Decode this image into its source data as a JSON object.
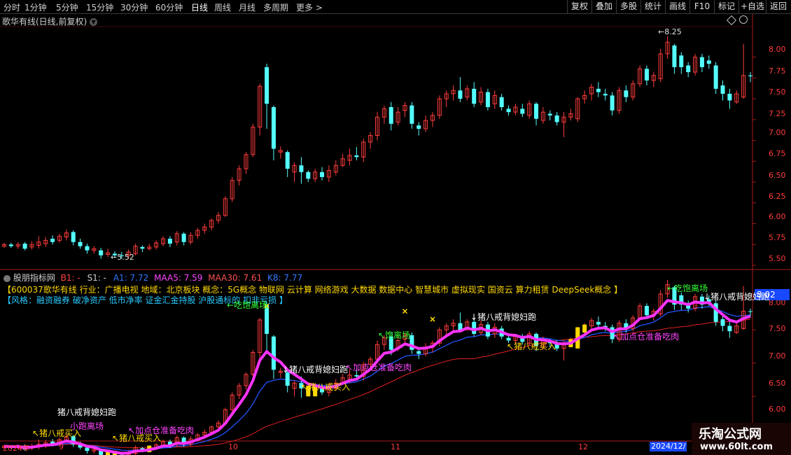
{
  "toolbar": {
    "tabs": [
      "分时",
      "1分钟",
      "5分钟",
      "15分钟",
      "30分钟",
      "60分钟",
      "日线",
      "周线",
      "月线",
      "多周期",
      "更多 >"
    ],
    "right_buttons": [
      "复权",
      "叠加",
      "多股",
      "统计",
      "画线",
      "F10",
      "标记",
      "+自选",
      "返回"
    ]
  },
  "upper": {
    "title": "歌华有线(日线,前复权)",
    "price_ticks": [
      "8.00",
      "7.75",
      "7.50",
      "7.25",
      "7.00",
      "6.75",
      "6.50",
      "6.25",
      "6.00",
      "5.75",
      "5.50"
    ],
    "high_label": "8.25",
    "low_label": "5.52"
  },
  "indicator": {
    "name": "股朋指标网",
    "b1_label": "B1: -",
    "s1_label": "S1: -",
    "a1_label": "A1: 7.72",
    "maa5_label": "MAA5: 7.59",
    "maa30_label": "MAA30: 7.61",
    "k8_label": "K8: 7.77",
    "info_line1": "【600037歌华有线 行业：广播电视 地域：北京板块 概念：5G概念 物联网 云计算 网络游戏 大数据 数据中心 智慧城市 虚拟现实 国资云 算力租赁 DeepSeek概念 】",
    "info_line2": "【风格：融资融券 破净资产 低市净率 证金汇金持股 沪股通标的 扣非亏损 】",
    "price_ticks": [
      "8.00",
      "7.50",
      "7.00",
      "6.50",
      "6.00"
    ],
    "current_value": "8.02"
  },
  "annotations": {
    "zhubajie_paolu": "猪八戒背媳妇跑",
    "zhubajie_buy": "猪八戒买入",
    "chibao_lichang": "吃饱离场",
    "jiadian_cang": "加点仓准备吃肉",
    "lichang_short": "饱离场",
    "xiaoqian": "小跑离场"
  },
  "dates": [
    "2024年",
    "9",
    "10",
    "11",
    "12",
    "2024/12/"
  ],
  "watermark": {
    "title": "乐淘公式网",
    "url": "www.60lt.com"
  },
  "colors": {
    "up": "#ff3c3c",
    "down": "#54ffff",
    "ma_magenta": "#ff33ff",
    "ma_blue": "#2255ff",
    "ma_red": "#e02020",
    "signal_yellow": "#ffd800",
    "label_green": "#33ff33",
    "label_white": "#ffffff"
  },
  "chart_data": {
    "type": "candlestick",
    "y_range_upper": [
      5.45,
      8.35
    ],
    "y_range_lower": [
      5.85,
      8.25
    ],
    "candles": [
      [
        5.73,
        5.75,
        5.71,
        5.77
      ],
      [
        5.75,
        5.73,
        5.71,
        5.77
      ],
      [
        5.73,
        5.75,
        5.7,
        5.78
      ],
      [
        5.76,
        5.7,
        5.68,
        5.78
      ],
      [
        5.72,
        5.75,
        5.69,
        5.79
      ],
      [
        5.74,
        5.78,
        5.7,
        5.85
      ],
      [
        5.76,
        5.8,
        5.72,
        5.84
      ],
      [
        5.82,
        5.78,
        5.75,
        5.86
      ],
      [
        5.8,
        5.85,
        5.77,
        5.88
      ],
      [
        5.84,
        5.89,
        5.8,
        5.93
      ],
      [
        5.9,
        5.78,
        5.74,
        5.92
      ],
      [
        5.78,
        5.73,
        5.7,
        5.82
      ],
      [
        5.73,
        5.68,
        5.64,
        5.76
      ],
      [
        5.68,
        5.7,
        5.64,
        5.73
      ],
      [
        5.68,
        5.62,
        5.58,
        5.71
      ],
      [
        5.63,
        5.65,
        5.6,
        5.7
      ],
      [
        5.64,
        5.62,
        5.59,
        5.67
      ],
      [
        5.62,
        5.61,
        5.58,
        5.66
      ],
      [
        5.62,
        5.66,
        5.58,
        5.69
      ],
      [
        5.64,
        5.73,
        5.62,
        5.76
      ],
      [
        5.72,
        5.7,
        5.66,
        5.74
      ],
      [
        5.7,
        5.72,
        5.68,
        5.76
      ],
      [
        5.72,
        5.77,
        5.69,
        5.8
      ],
      [
        5.76,
        5.82,
        5.73,
        5.85
      ],
      [
        5.82,
        5.76,
        5.72,
        5.85
      ],
      [
        5.78,
        5.88,
        5.74,
        5.91
      ],
      [
        5.88,
        5.78,
        5.74,
        5.9
      ],
      [
        5.78,
        5.86,
        5.75,
        5.9
      ],
      [
        5.86,
        5.92,
        5.82,
        5.95
      ],
      [
        5.92,
        5.96,
        5.88,
        6.0
      ],
      [
        5.96,
        6.04,
        5.92,
        6.06
      ],
      [
        6.04,
        6.1,
        6.0,
        6.14
      ],
      [
        6.1,
        6.3,
        6.08,
        6.33
      ],
      [
        6.3,
        6.52,
        6.26,
        6.56
      ],
      [
        6.52,
        6.66,
        6.46,
        6.7
      ],
      [
        6.66,
        6.83,
        6.6,
        6.86
      ],
      [
        6.83,
        7.16,
        6.8,
        7.2
      ],
      [
        7.16,
        7.65,
        7.06,
        7.68
      ],
      [
        7.88,
        7.44,
        7.14,
        7.92
      ],
      [
        7.4,
        6.9,
        6.76,
        7.42
      ],
      [
        6.86,
        6.88,
        6.78,
        6.93
      ],
      [
        6.86,
        6.66,
        6.56,
        6.88
      ],
      [
        6.62,
        6.7,
        6.5,
        6.74
      ],
      [
        6.7,
        6.62,
        6.48,
        6.8
      ],
      [
        6.62,
        6.54,
        6.5,
        6.64
      ],
      [
        6.54,
        6.62,
        6.5,
        6.66
      ],
      [
        6.62,
        6.56,
        6.52,
        6.68
      ],
      [
        6.56,
        6.64,
        6.5,
        6.7
      ],
      [
        6.62,
        6.7,
        6.58,
        6.76
      ],
      [
        6.7,
        6.78,
        6.68,
        6.84
      ],
      [
        6.76,
        6.82,
        6.7,
        6.9
      ],
      [
        6.82,
        6.8,
        6.76,
        6.92
      ],
      [
        6.8,
        6.98,
        6.74,
        7.02
      ],
      [
        6.98,
        7.06,
        6.9,
        7.1
      ],
      [
        7.06,
        7.28,
        7.0,
        7.34
      ],
      [
        7.28,
        7.38,
        7.2,
        7.42
      ],
      [
        7.4,
        7.2,
        7.12,
        7.46
      ],
      [
        7.22,
        7.34,
        7.18,
        7.4
      ],
      [
        7.36,
        7.42,
        7.28,
        7.46
      ],
      [
        7.42,
        7.2,
        7.14,
        7.46
      ],
      [
        7.18,
        7.14,
        7.06,
        7.22
      ],
      [
        7.14,
        7.24,
        7.1,
        7.3
      ],
      [
        7.24,
        7.3,
        7.16,
        7.34
      ],
      [
        7.3,
        7.5,
        7.26,
        7.54
      ],
      [
        7.5,
        7.56,
        7.4,
        7.6
      ],
      [
        7.56,
        7.6,
        7.48,
        7.66
      ],
      [
        7.6,
        7.5,
        7.46,
        7.76
      ],
      [
        7.52,
        7.62,
        7.48,
        7.66
      ],
      [
        7.62,
        7.44,
        7.4,
        7.7
      ],
      [
        7.46,
        7.58,
        7.42,
        7.64
      ],
      [
        7.58,
        7.4,
        7.36,
        7.62
      ],
      [
        7.44,
        7.54,
        7.38,
        7.6
      ],
      [
        7.52,
        7.4,
        7.36,
        7.56
      ],
      [
        7.38,
        7.34,
        7.3,
        7.42
      ],
      [
        7.34,
        7.4,
        7.3,
        7.44
      ],
      [
        7.38,
        7.32,
        7.28,
        7.44
      ],
      [
        7.3,
        7.44,
        7.26,
        7.48
      ],
      [
        7.44,
        7.26,
        7.18,
        7.46
      ],
      [
        7.24,
        7.34,
        7.2,
        7.4
      ],
      [
        7.32,
        7.3,
        7.24,
        7.36
      ],
      [
        7.3,
        7.22,
        7.18,
        7.34
      ],
      [
        7.22,
        7.28,
        7.04,
        7.34
      ],
      [
        7.28,
        7.32,
        7.24,
        7.38
      ],
      [
        7.26,
        7.5,
        7.22,
        7.52
      ],
      [
        7.5,
        7.54,
        7.44,
        7.6
      ],
      [
        7.56,
        7.64,
        7.48,
        7.68
      ],
      [
        7.62,
        7.58,
        7.52,
        7.7
      ],
      [
        7.56,
        7.54,
        7.48,
        7.62
      ],
      [
        7.54,
        7.36,
        7.3,
        7.58
      ],
      [
        7.36,
        7.6,
        7.32,
        7.64
      ],
      [
        7.6,
        7.52,
        7.46,
        7.66
      ],
      [
        7.52,
        7.68,
        7.48,
        7.72
      ],
      [
        7.68,
        7.86,
        7.64,
        7.9
      ],
      [
        7.86,
        7.72,
        7.66,
        7.9
      ],
      [
        7.72,
        7.78,
        7.64,
        7.82
      ],
      [
        7.74,
        8.04,
        7.7,
        8.1
      ],
      [
        8.04,
        8.18,
        7.98,
        8.25
      ],
      [
        8.14,
        7.88,
        7.8,
        8.16
      ],
      [
        8.02,
        7.88,
        7.8,
        8.06
      ],
      [
        7.9,
        7.82,
        7.76,
        7.94
      ],
      [
        7.82,
        8.0,
        7.78,
        8.04
      ],
      [
        8.0,
        7.88,
        7.82,
        8.04
      ],
      [
        7.96,
        7.92,
        7.86,
        8.02
      ],
      [
        7.9,
        7.62,
        7.56,
        7.94
      ],
      [
        7.66,
        7.56,
        7.48,
        7.72
      ],
      [
        7.56,
        7.48,
        7.38,
        7.62
      ],
      [
        7.46,
        7.56,
        7.44,
        7.6
      ],
      [
        7.52,
        7.78,
        7.5,
        8.16
      ],
      [
        7.78,
        7.77,
        7.7,
        7.82
      ]
    ]
  }
}
